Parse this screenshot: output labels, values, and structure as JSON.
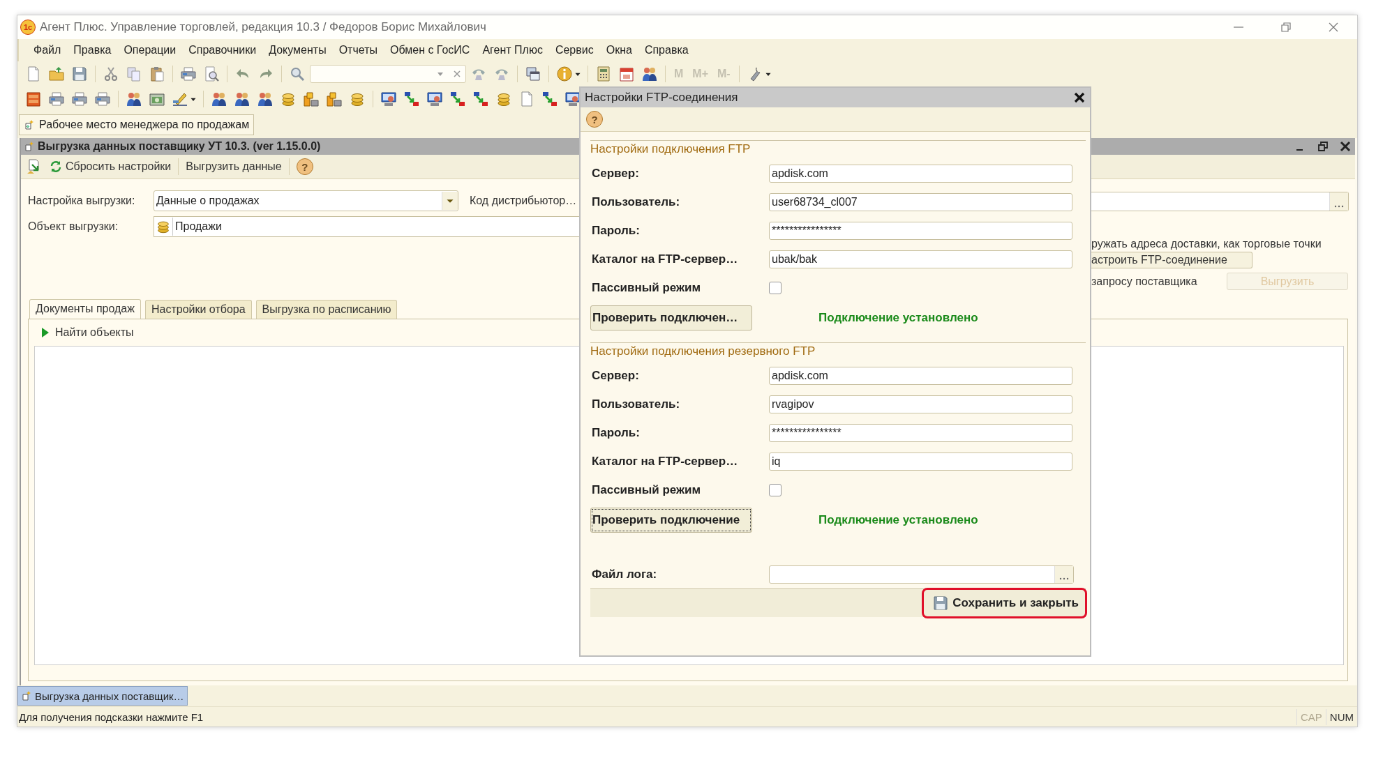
{
  "window": {
    "title": "Агент Плюс. Управление торговлей, редакция 10.3 / Федоров Борис Михайлович",
    "logo": "1с"
  },
  "menu": [
    {
      "label": "Файл"
    },
    {
      "label": "Правка"
    },
    {
      "label": "Операции"
    },
    {
      "label": "Справочники"
    },
    {
      "label": "Документы"
    },
    {
      "label": "Отчеты"
    },
    {
      "label": "Обмен с ГосИС"
    },
    {
      "label": "Агент Плюс"
    },
    {
      "label": "Сервис"
    },
    {
      "label": "Окна"
    },
    {
      "label": "Справка"
    }
  ],
  "memory_buttons": [
    {
      "label": "M",
      "disabled": true
    },
    {
      "label": "M+",
      "disabled": true
    },
    {
      "label": "M-",
      "disabled": true
    }
  ],
  "open_tabs": [
    {
      "label": "Рабочее место менеджера по продажам"
    }
  ],
  "form_window": {
    "title": "Выгрузка данных поставщику УТ 10.3. (ver 1.15.0.0)",
    "help": "?",
    "toolbar": [
      {
        "label": "Сбросить настройки"
      },
      {
        "label": "Выгрузить данные"
      }
    ]
  },
  "form": {
    "fields": [
      {
        "label": "Настройка выгрузки:",
        "value": "Данные о продажах",
        "kind": "combo"
      },
      {
        "label": "Объект выгрузки:",
        "value": "Продажи",
        "kind": "object"
      }
    ],
    "distributor_label": "Код дистрибьютор…",
    "delivery_option": "ружать адреса доставки, как торговые точки",
    "ftp_button": "астроить FTP-соединение",
    "request_label": "запросу поставщика",
    "upload_button": {
      "label": "Выгрузить",
      "disabled": true
    }
  },
  "tabs": [
    {
      "label": "Документы продаж",
      "selected": true
    },
    {
      "label": "Настройки отбора",
      "selected": false
    },
    {
      "label": "Выгрузка по расписанию",
      "selected": false
    }
  ],
  "find_objects": "Найти объекты",
  "dialog": {
    "title": "Настройки FTP-соединения",
    "help": "?",
    "sections": [
      {
        "title": "Настройки подключения FTP",
        "fields": [
          {
            "label": "Сервер:",
            "kind": "text",
            "value": "apdisk.com"
          },
          {
            "label": "Пользователь:",
            "kind": "text",
            "value": "user68734_cl007"
          },
          {
            "label": "Пароль:",
            "kind": "text",
            "value": "****************"
          },
          {
            "label": "Каталог на FTP-сервер…",
            "kind": "text",
            "value": "ubak/bak"
          },
          {
            "label": "Пассивный режим",
            "kind": "checkbox",
            "checked": false
          }
        ],
        "button": {
          "label": "Проверить подключен…",
          "focused": false
        },
        "status": "Подключение установлено"
      },
      {
        "title": "Настройки подключения резервного FTP",
        "fields": [
          {
            "label": "Сервер:",
            "kind": "text",
            "value": "apdisk.com"
          },
          {
            "label": "Пользователь:",
            "kind": "text",
            "value": "rvagipov"
          },
          {
            "label": "Пароль:",
            "kind": "text",
            "value": "****************"
          },
          {
            "label": "Каталог на FTP-сервер…",
            "kind": "text",
            "value": "iq"
          },
          {
            "label": "Пассивный режим",
            "kind": "checkbox",
            "checked": false
          }
        ],
        "button": {
          "label": "Проверить подключение",
          "focused": true
        },
        "status": "Подключение установлено"
      }
    ],
    "log_label": "Файл лога:",
    "save_button": {
      "label": "Сохранить и закрыть",
      "highlighted": true
    }
  },
  "taskbar": [
    {
      "label": "Выгрузка данных поставщик…",
      "selected": true
    }
  ],
  "status_bar": {
    "hint": "Для получения подсказки нажмите F1",
    "indicators": [
      {
        "label": "CAP",
        "on": false
      },
      {
        "label": "NUM",
        "on": true
      }
    ]
  }
}
